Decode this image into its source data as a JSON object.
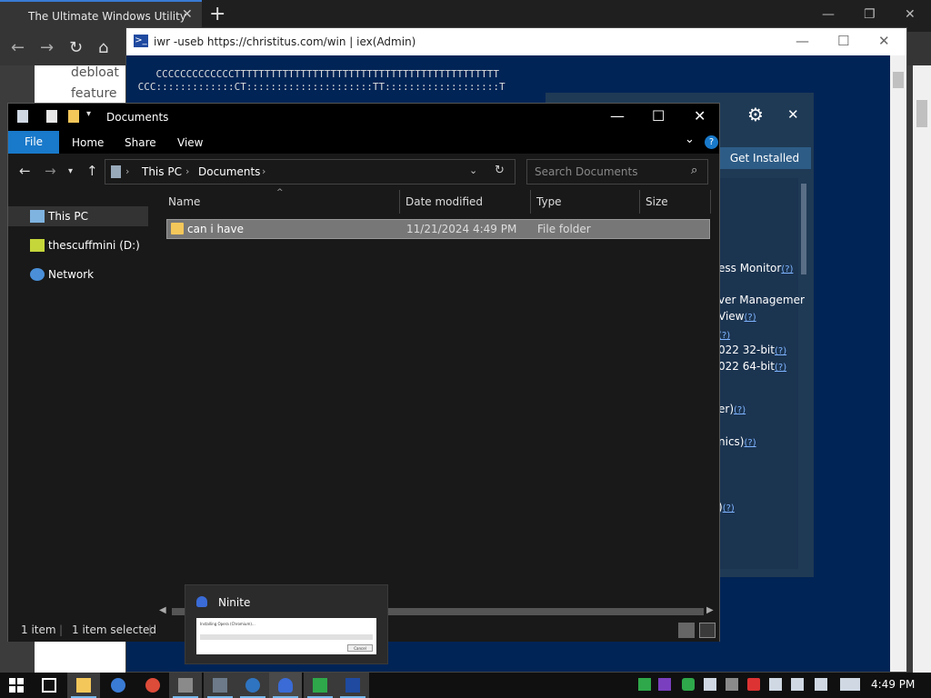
{
  "browser": {
    "tab_title": "The Ultimate Windows Utility",
    "new_tab_icon": "plus-icon",
    "page_text": [
      "debloat",
      "feature"
    ]
  },
  "powershell": {
    "title": "iwr -useb https://christitus.com/win | iex(Admin)",
    "console_lines": [
      "    CCCCCCCCCCCCCTTTTTTTTTTTTTTTTTTTTTTTTTTTTTTTTTTTTTTTTTTTT",
      " CCC:::::::::::::CT:::::::::::::::::::::TT:::::::::::::::::::T"
    ]
  },
  "winutil": {
    "get_installed_label": "Get Installed",
    "help_marker": "(?)",
    "items": [
      {
        "text": "ess Monitor",
        "q": true
      },
      {
        "text": "ver Managemer",
        "q": false
      },
      {
        "text": "View",
        "q": true
      },
      {
        "text": "",
        "q": true
      },
      {
        "text": "022 32-bit",
        "q": true
      },
      {
        "text": "022 64-bit",
        "q": true
      },
      {
        "text": "er)",
        "q": true
      },
      {
        "text": "nics)",
        "q": true
      },
      {
        "text": ")",
        "q": true
      }
    ]
  },
  "explorer": {
    "title": "Documents",
    "ribbon": {
      "file": "File",
      "home": "Home",
      "share": "Share",
      "view": "View",
      "help": "?"
    },
    "breadcrumb": [
      "This PC",
      "Documents"
    ],
    "search_placeholder": "Search Documents",
    "nav_pane": [
      {
        "label": "This PC",
        "icon": "computer-icon",
        "selected": true
      },
      {
        "label": "thescuffmini (D:)",
        "icon": "drive-icon",
        "selected": false
      },
      {
        "label": "Network",
        "icon": "network-icon",
        "selected": false
      }
    ],
    "columns": [
      "Name",
      "Date modified",
      "Type",
      "Size"
    ],
    "rows": [
      {
        "name": "can i have",
        "date": "11/21/2024 4:49 PM",
        "type": "File folder",
        "size": ""
      }
    ],
    "status": {
      "items": "1 item",
      "selected": "1 item selected"
    }
  },
  "ninite": {
    "label": "Ninite",
    "status_text": "Installing Opera (Chromium)...",
    "cancel_label": "Cancel"
  },
  "taskbar": {
    "clock": "4:49 PM",
    "apps": [
      "start-icon",
      "task-view-icon",
      "file-explorer-icon",
      "app-icon",
      "chrome-icon",
      "app-icon",
      "app-icon",
      "app-icon",
      "ninite-icon",
      "app-icon",
      "powershell-icon"
    ]
  },
  "colors": {
    "accent": "#1979ca",
    "powershell_bg": "#012456",
    "winutil_bg": "#1f3a55",
    "folder": "#f4c75a"
  }
}
